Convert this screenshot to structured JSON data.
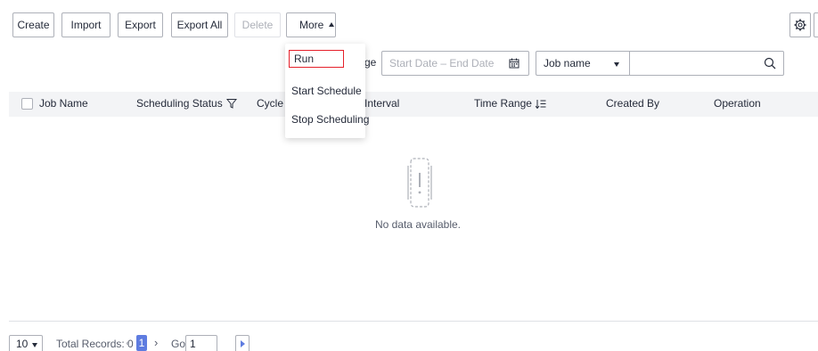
{
  "toolbar": {
    "create_label": "Create",
    "import_label": "Import",
    "export_label": "Export",
    "export_all_label": "Export All",
    "delete_label": "Delete",
    "more_label": "More"
  },
  "more_menu": {
    "items": [
      {
        "label": "Run"
      },
      {
        "label": "Start Schedule"
      },
      {
        "label": "Stop Scheduling"
      }
    ]
  },
  "filters": {
    "partial_label": "ge",
    "date_range_placeholder": "Start Date – End Date",
    "search_field": "Job name",
    "search_value": ""
  },
  "table": {
    "columns": [
      {
        "label": "Job Name"
      },
      {
        "label": "Scheduling Status"
      },
      {
        "label": "Cycle"
      },
      {
        "label": "Interval"
      },
      {
        "label": "Time Range"
      },
      {
        "label": "Created By"
      },
      {
        "label": "Operation"
      }
    ],
    "rows": [],
    "empty_text": "No data available."
  },
  "pagination": {
    "page_size": "10",
    "total_records": "Total Records: 0",
    "current_page": "1",
    "go_label": "Go",
    "go_value": "1"
  },
  "colors": {
    "accent": "#5e7ce0",
    "highlight_border": "#e5202a",
    "header_bg": "#f3f4f6",
    "border": "#adb0b8"
  },
  "icons": [
    "chevron-up-icon",
    "gear-icon",
    "calendar-icon",
    "chevron-down-icon",
    "search-icon",
    "filter-icon",
    "sort-icon",
    "empty-state-icon",
    "chevron-left-icon",
    "chevron-right-icon",
    "jump-icon"
  ]
}
